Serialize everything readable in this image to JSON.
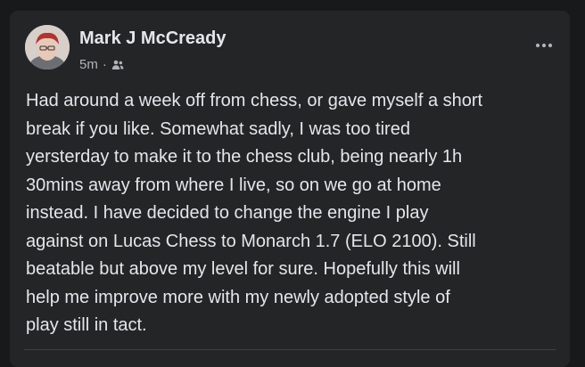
{
  "post": {
    "author": "Mark J McCready",
    "timestamp": "5m",
    "separator": "·",
    "audience_icon": "friends-icon",
    "more_icon": "more-horizontal-icon",
    "text": "Had around a week off from chess, or gave myself a short\nbreak if you like. Somewhat sadly, I was too tired\nyersterday to make it to the chess club, being nearly 1h\n30mins away from where I live, so on we go at home\ninstead.  I have decided to change the engine I play\nagainst on Lucas Chess to Monarch 1.7 (ELO 2100). Still\nbeatable but above my level for sure. Hopefully this will\nhelp me improve more with my newly adopted style of\nplay still in tact."
  },
  "colors": {
    "page_background": "#18191a",
    "card_background": "#242526",
    "primary_text": "#e4e6eb",
    "secondary_text": "#b0b3b8",
    "divider": "#3e4042"
  }
}
